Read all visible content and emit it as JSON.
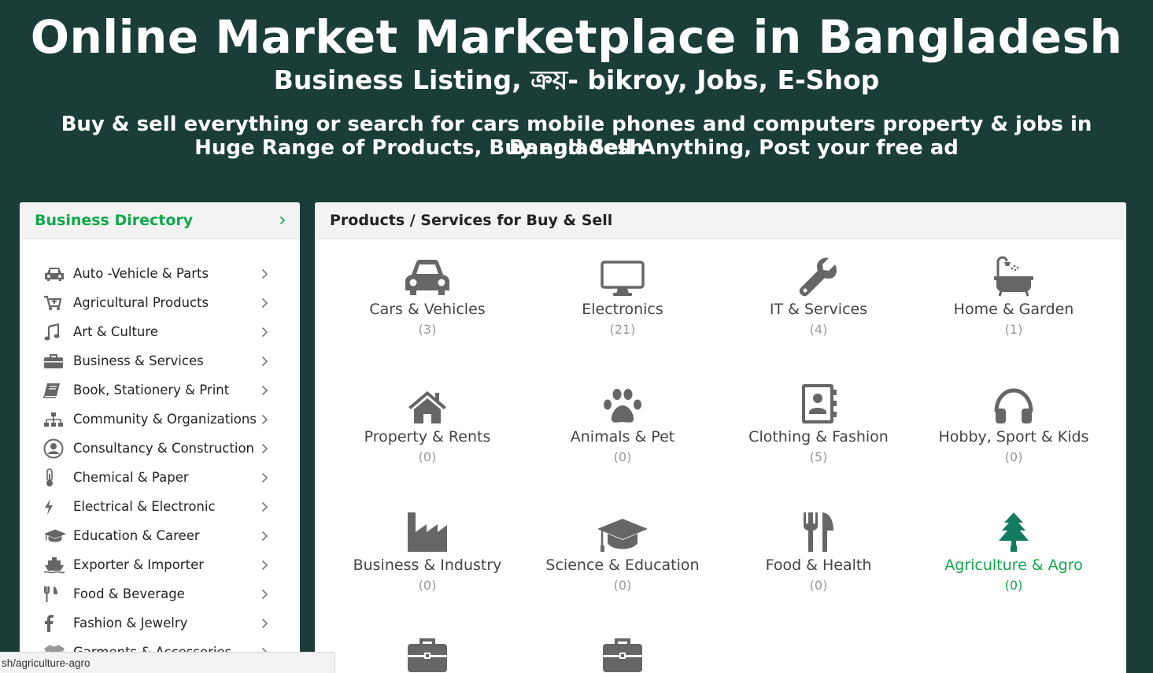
{
  "hero": {
    "title": "Online Market Marketplace in Bangladesh",
    "subtitle": "Business Listing, ক্রয়- bikroy, Jobs, E-Shop",
    "tagline1": "Buy & sell everything or search for cars mobile phones and computers property & jobs in Bangladesh",
    "tagline2": "Huge Range of Products, Buy and Sell Anything, Post your free ad"
  },
  "sidebar": {
    "title": "Business Directory",
    "items": [
      {
        "label": "Auto -Vehicle & Parts",
        "icon": "car-icon"
      },
      {
        "label": "Agricultural Products",
        "icon": "cart-plus-icon"
      },
      {
        "label": "Art & Culture",
        "icon": "music-note-icon"
      },
      {
        "label": "Business & Services",
        "icon": "briefcase-icon"
      },
      {
        "label": "Book, Stationery & Print",
        "icon": "book-icon"
      },
      {
        "label": "Community & Organizations",
        "icon": "sitemap-icon"
      },
      {
        "label": "Consultancy & Construction",
        "icon": "user-circle-icon"
      },
      {
        "label": "Chemical & Paper",
        "icon": "thermometer-icon"
      },
      {
        "label": "Electrical & Electronic",
        "icon": "bolt-icon"
      },
      {
        "label": "Education & Career",
        "icon": "graduation-cap-icon"
      },
      {
        "label": "Exporter & Importer",
        "icon": "ship-icon"
      },
      {
        "label": "Food & Beverage",
        "icon": "cutlery-icon"
      },
      {
        "label": "Fashion & Jewelry",
        "icon": "facebook-f-icon"
      },
      {
        "label": "Garments & Accessories",
        "icon": "shirt-icon"
      }
    ]
  },
  "main": {
    "title": "Products / Services for Buy & Sell",
    "categories": [
      {
        "name": "Cars & Vehicles",
        "count": "(3)",
        "icon": "car-icon"
      },
      {
        "name": "Electronics",
        "count": "(21)",
        "icon": "desktop-icon"
      },
      {
        "name": "IT & Services",
        "count": "(4)",
        "icon": "wrench-icon"
      },
      {
        "name": "Home & Garden",
        "count": "(1)",
        "icon": "bathtub-icon"
      },
      {
        "name": "Property & Rents",
        "count": "(0)",
        "icon": "home-icon"
      },
      {
        "name": "Animals & Pet",
        "count": "(0)",
        "icon": "paw-icon"
      },
      {
        "name": "Clothing & Fashion",
        "count": "(5)",
        "icon": "address-book-icon"
      },
      {
        "name": "Hobby, Sport & Kids",
        "count": "(0)",
        "icon": "headphones-icon"
      },
      {
        "name": "Business & Industry",
        "count": "(0)",
        "icon": "industry-icon"
      },
      {
        "name": "Science & Education",
        "count": "(0)",
        "icon": "graduation-cap-icon"
      },
      {
        "name": "Food & Health",
        "count": "(0)",
        "icon": "cutlery-icon"
      },
      {
        "name": "Agriculture & Agro",
        "count": "(0)",
        "icon": "tree-icon"
      }
    ],
    "extra_icons": [
      "briefcase-icon",
      "briefcase-icon"
    ]
  },
  "status_bar": {
    "url": "sh/agriculture-agro"
  },
  "colors": {
    "background": "#1a3d38",
    "accent": "#10a84a",
    "icon": "#666666"
  }
}
